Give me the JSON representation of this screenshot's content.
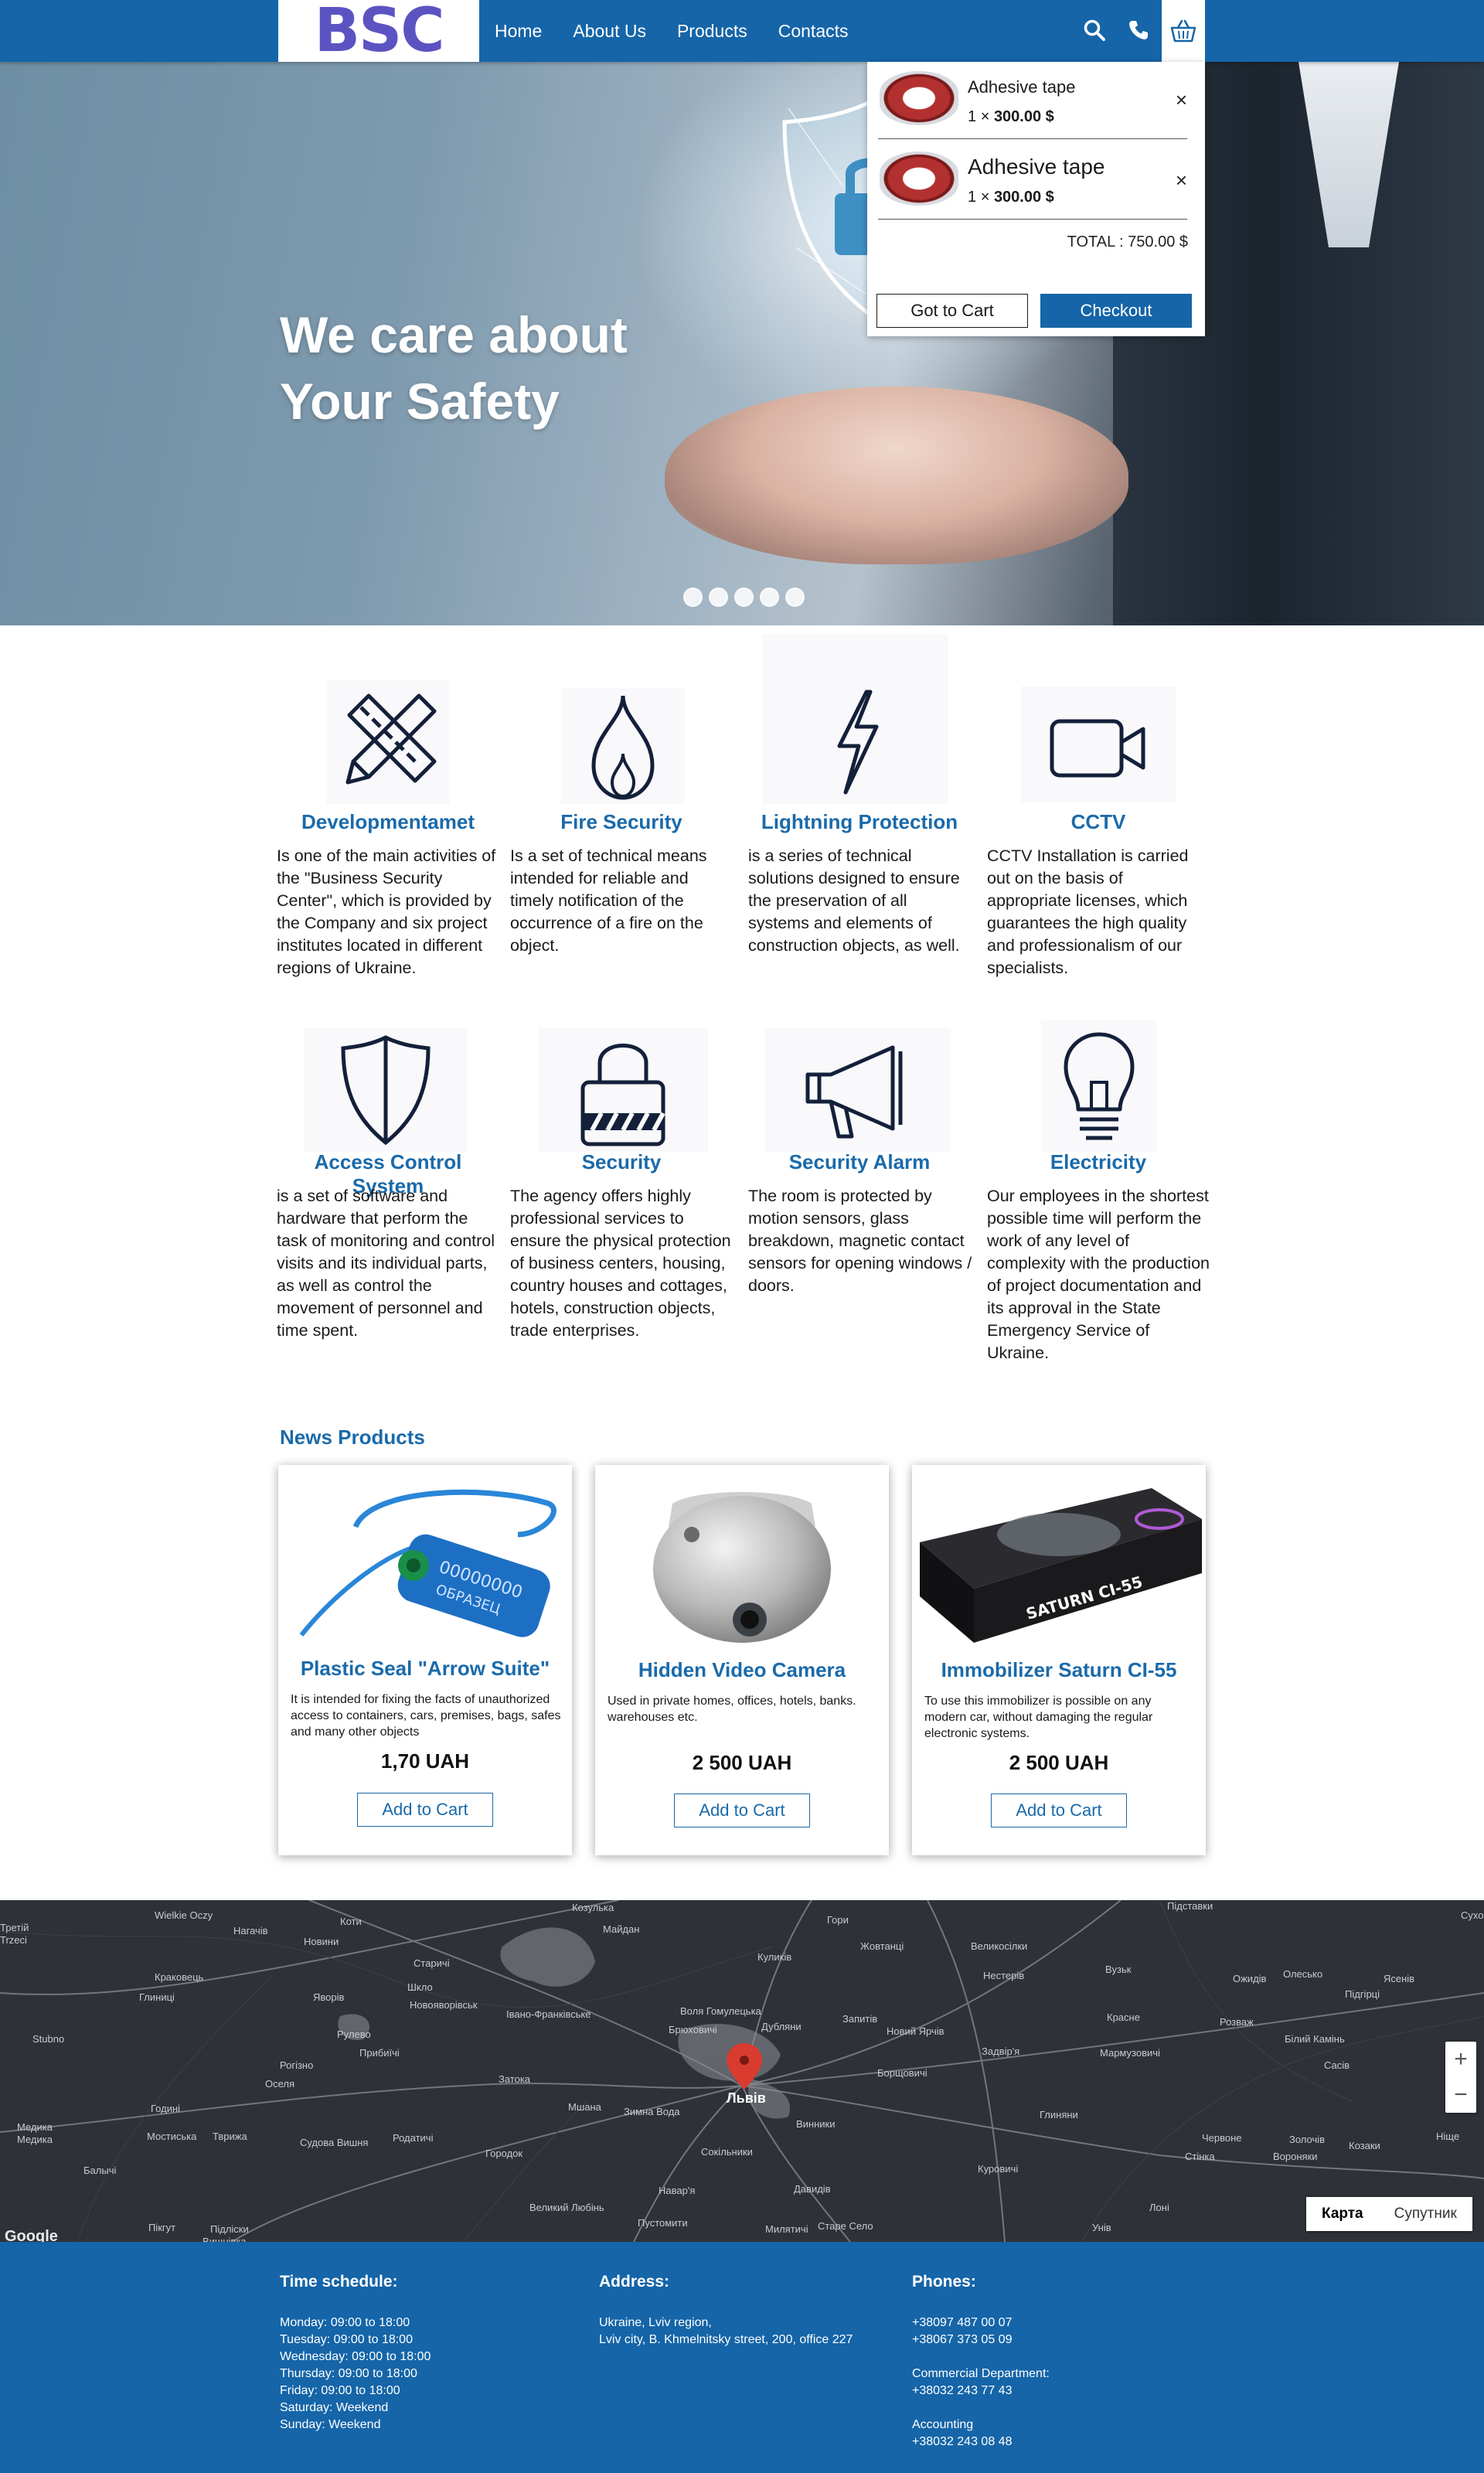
{
  "header": {
    "logo_text": "BSC",
    "nav": [
      "Home",
      "About Us",
      "Products",
      "Contacts"
    ],
    "icons": [
      "search-icon",
      "phone-icon",
      "basket-icon"
    ],
    "colors": {
      "primary": "#1565a8",
      "logo": "#5c53c2",
      "accent_text": "#1a6aaa"
    }
  },
  "hero": {
    "title_line1": "We care about",
    "title_line2": "Your Safety",
    "slides_count": 5
  },
  "cart": {
    "items": [
      {
        "name": "Adhesive tape",
        "qty": "1",
        "times": "×",
        "price": "300.00 $"
      },
      {
        "name": "Adhesive tape",
        "qty": "1",
        "times": "×",
        "price": "300.00 $"
      }
    ],
    "total": "TOTAL : 750.00 $",
    "go_to_cart": "Got to Cart",
    "checkout": "Checkout",
    "remove_symbol": "×"
  },
  "services": [
    {
      "title": "Developmentamet",
      "icon": "ruler-pencil-icon",
      "text": "Is one of the main activities of the \"Business Security Center\", which is provided by the Company and six project institutes located in different regions of Ukraine."
    },
    {
      "title": "Fire Security",
      "icon": "flame-icon",
      "text": "Is a set of technical means intended for reliable and timely notification of the occurrence of a fire on the object."
    },
    {
      "title": "Lightning Protection",
      "icon": "lightning-icon",
      "text": "is a series of technical solutions designed to ensure the preservation of all systems and elements of construction objects, as well."
    },
    {
      "title": "CCTV",
      "icon": "video-camera-icon",
      "text": "CCTV Installation is carried out on the basis of appropriate licenses, which guarantees the high quality and professionalism of our specialists."
    },
    {
      "title": "Access Control System",
      "icon": "shield-icon",
      "text": "is a set of software and hardware that perform the task of monitoring and control visits and its individual parts, as well as control the movement of personnel and time spent."
    },
    {
      "title": "Security",
      "icon": "padlock-icon",
      "text": "The agency offers highly professional services to ensure the physical protection of business centers, housing, country houses and cottages, hotels, construction objects, trade enterprises."
    },
    {
      "title": "Security Alarm",
      "icon": "megaphone-icon",
      "text": "The room is protected by motion sensors, glass breakdown, magnetic contact sensors for opening windows / doors."
    },
    {
      "title": "Electricity",
      "icon": "lightbulb-icon",
      "text": "Our employees in the shortest possible time will perform the work of any level of complexity with the production of project documentation and its approval in the  State Emergency Service of Ukraine."
    }
  ],
  "news": {
    "title": "News Products",
    "products": [
      {
        "title": "Plastic Seal \"Arrow Suite\"",
        "desc": "It is intended for fixing the facts of unauthorized access to containers, cars, premises, bags, safes and many other objects",
        "price": "1,70 UAH",
        "button": "Add to Cart",
        "seal_number": "00000000",
        "seal_word": "ОБРАЗЕЦ"
      },
      {
        "title": "Hidden Video Camera",
        "desc": "Used in private homes, offices, hotels, banks. warehouses etc.",
        "price": "2 500 UAH",
        "button": "Add to Cart"
      },
      {
        "title": "Immobilizer Saturn CI-55",
        "desc": "To use this immobilizer is possible on any modern car, without damaging the regular electronic systems.",
        "price": "2 500 UAH",
        "button": "Add to Cart",
        "box_text": "SATURN CI-55"
      }
    ]
  },
  "map": {
    "city": "Львів",
    "places": [
      "Wielkie Oczy",
      "Нагачів",
      "Коти",
      "Козулька",
      "Майдан",
      "Гори",
      "Підставки",
      "Сухо",
      "Третій",
      "Trzeci",
      "Новини",
      "Старичі",
      "Куликів",
      "Жовтанці",
      "Великосілки",
      "Краковець",
      "Глиниці",
      "Яворів",
      "Шкло",
      "Новояворівськ",
      "Нестерів",
      "Вузьк",
      "Ожидів",
      "Олесько",
      "Ясенів",
      "Підгірці",
      "Івано-Франківське",
      "Воля Гомулецька",
      "Брюховичі",
      "Дубляни",
      "Запитів",
      "Новий Ярчів",
      "Красне",
      "Розваж",
      "Білий Камінь",
      "Stubno",
      "Рулево",
      "Прибиїчі",
      "Задвір'я",
      "Мармузовичі",
      "Сасів",
      "Рогізно",
      "Оселя",
      "Затока",
      "Борщовичі",
      "Мшана",
      "Зимна Вода",
      "Винники",
      "Глиняни",
      "Годині",
      "Медика",
      "Мостиська",
      "Тврижа",
      "Судова Вишня",
      "Родатичі",
      "Городок",
      "Сокільники",
      "Червоне",
      "Золочів",
      "Козаки",
      "Ніще",
      "Стінка",
      "Вороняки",
      "Балычі",
      "Давидів",
      "Навар'я",
      "Куровичі",
      "Великий Любінь",
      "Пустомити",
      "Милятичі",
      "Старе Село",
      "Лоні",
      "Унів",
      "Пікгут",
      "Підліски",
      "Вишнівка",
      "Медика"
    ],
    "zoom_in": "+",
    "zoom_out": "−",
    "type_map": "Карта",
    "type_sat": "Супутник",
    "google": "Google"
  },
  "footer": {
    "schedule_title": "Time schedule:",
    "schedule": [
      "Monday: 09:00 to 18:00",
      "Tuesday: 09:00 to 18:00",
      "Wednesday: 09:00 to 18:00",
      "Thursday: 09:00 to 18:00",
      "Friday: 09:00 to 18:00",
      "Saturday: Weekend",
      "Sunday: Weekend"
    ],
    "address_title": "Address:",
    "address": [
      "Ukraine, Lviv region,",
      "Lviv city, B. Khmelnitsky  street, 200, office 227"
    ],
    "phones_title": "Phones:",
    "phones": [
      "+38097 487 00 07",
      "+38067 373 05 09"
    ],
    "commercial_title": "Commercial Department:",
    "commercial": "+38032 243 77 43",
    "accounting_title": "Accounting",
    "accounting": "+38032 243 08 48"
  }
}
